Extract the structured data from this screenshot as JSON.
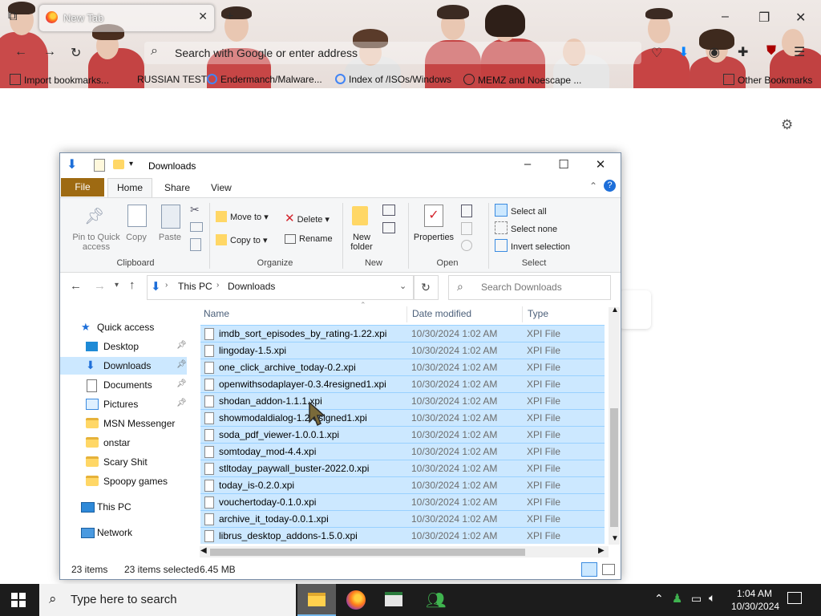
{
  "browser": {
    "tab_title": "New Tab",
    "url_placeholder": "Search with Google or enter address",
    "bookmarks": [
      "Import bookmarks...",
      "RUSSIAN TEST",
      "Endermanch/Malware...",
      "Index of /ISOs/Windows",
      "MEMZ and Noescape ...",
      "Other Bookmarks"
    ]
  },
  "explorer": {
    "title": "Downloads",
    "menu_tabs": {
      "file": "File",
      "home": "Home",
      "share": "Share",
      "view": "View"
    },
    "ribbon": {
      "pin_label": "Pin to Quick access",
      "copy": "Copy",
      "paste": "Paste",
      "clipboard": "Clipboard",
      "move_to": "Move to",
      "copy_to": "Copy to",
      "delete": "Delete",
      "rename": "Rename",
      "organize": "Organize",
      "new_folder": "New folder",
      "new": "New",
      "properties": "Properties",
      "open": "Open",
      "select_all": "Select all",
      "select_none": "Select none",
      "invert_selection": "Invert selection",
      "select": "Select"
    },
    "address": {
      "this_pc": "This PC",
      "current": "Downloads",
      "search_placeholder": "Search Downloads"
    },
    "nav": {
      "quick_access": "Quick access",
      "items": [
        "Desktop",
        "Downloads",
        "Documents",
        "Pictures",
        "MSN Messenger",
        "onstar",
        "Scary Shit",
        "Spoopy games"
      ],
      "this_pc": "This PC",
      "network": "Network"
    },
    "columns": {
      "name": "Name",
      "date": "Date modified",
      "type": "Type"
    },
    "files": [
      {
        "name": "imdb_sort_episodes_by_rating-1.22.xpi",
        "date": "10/30/2024 1:02 AM",
        "type": "XPI File"
      },
      {
        "name": "lingoday-1.5.xpi",
        "date": "10/30/2024 1:02 AM",
        "type": "XPI File"
      },
      {
        "name": "one_click_archive_today-0.2.xpi",
        "date": "10/30/2024 1:02 AM",
        "type": "XPI File"
      },
      {
        "name": "openwithsodaplayer-0.3.4resigned1.xpi",
        "date": "10/30/2024 1:02 AM",
        "type": "XPI File"
      },
      {
        "name": "shodan_addon-1.1.1.xpi",
        "date": "10/30/2024 1:02 AM",
        "type": "XPI File"
      },
      {
        "name": "showmodaldialog-1.2resigned1.xpi",
        "date": "10/30/2024 1:02 AM",
        "type": "XPI File"
      },
      {
        "name": "soda_pdf_viewer-1.0.0.1.xpi",
        "date": "10/30/2024 1:02 AM",
        "type": "XPI File"
      },
      {
        "name": "somtoday_mod-4.4.xpi",
        "date": "10/30/2024 1:02 AM",
        "type": "XPI File"
      },
      {
        "name": "stltoday_paywall_buster-2022.0.xpi",
        "date": "10/30/2024 1:02 AM",
        "type": "XPI File"
      },
      {
        "name": "today_is-0.2.0.xpi",
        "date": "10/30/2024 1:02 AM",
        "type": "XPI File"
      },
      {
        "name": "vouchertoday-0.1.0.xpi",
        "date": "10/30/2024 1:02 AM",
        "type": "XPI File"
      },
      {
        "name": "archive_it_today-0.0.1.xpi",
        "date": "10/30/2024 1:02 AM",
        "type": "XPI File"
      },
      {
        "name": "librus_desktop_addons-1.5.0.xpi",
        "date": "10/30/2024 1:02 AM",
        "type": "XPI File"
      }
    ],
    "status": {
      "items": "23 items",
      "selected": "23 items selected",
      "size": "6.45 MB"
    }
  },
  "taskbar": {
    "search_placeholder": "Type here to search",
    "time": "1:04 AM",
    "date": "10/30/2024"
  },
  "colors": {
    "selection": "#cce8ff",
    "file_tab": "#9e6a12",
    "accent": "#0078d7",
    "taskbar": "#1c1c1c"
  }
}
